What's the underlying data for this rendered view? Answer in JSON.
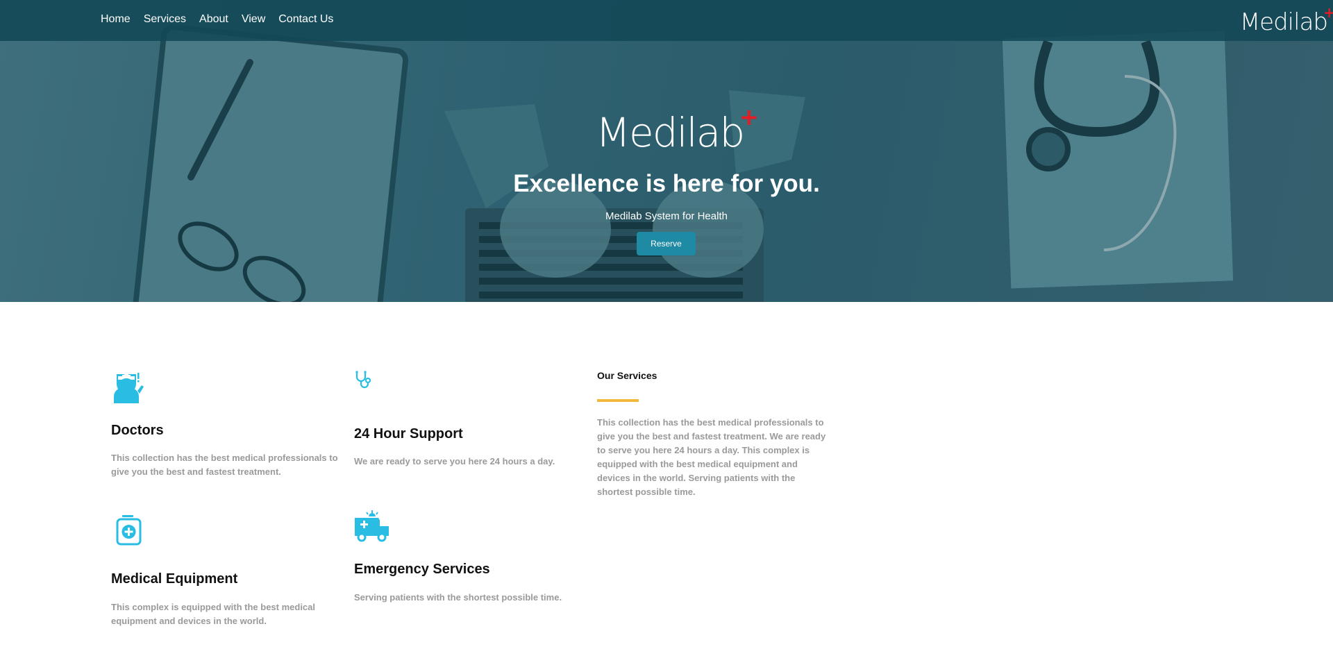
{
  "nav": {
    "links": [
      "Home",
      "Services",
      "About",
      "View",
      "Contact Us"
    ],
    "brand": "Medilab",
    "brand_mark": "+"
  },
  "hero": {
    "logo": "Medilab",
    "logo_mark": "+",
    "title": "Excellence is here for you.",
    "subtitle": "Medilab System for Health",
    "button": "Reserve"
  },
  "features": [
    {
      "icon": "doctor-icon",
      "title": "Doctors",
      "text": "This collection has the best medical professionals to give you the best and fastest treatment."
    },
    {
      "icon": "stethoscope-icon",
      "title": "24 Hour Support",
      "text": "We are ready to serve you here 24 hours a day."
    },
    {
      "icon": "medical-kit-icon",
      "title": "Medical Equipment",
      "text": "This complex is equipped with the best medical equipment and devices in the world."
    },
    {
      "icon": "ambulance-icon",
      "title": "Emergency Services",
      "text": "Serving patients with the shortest possible time."
    }
  ],
  "services": {
    "heading": "Our Services",
    "text": "This collection has the best medical professionals to give you the best and fastest treatment. We are ready to serve you here 24 hours a day. This complex is equipped with the best medical equipment and devices in the world. Serving patients with the shortest possible time."
  },
  "colors": {
    "accent": "#1e8aa4",
    "icon": "#29bde4",
    "underline": "#f3b73a",
    "brand_plus": "#e61b23"
  }
}
